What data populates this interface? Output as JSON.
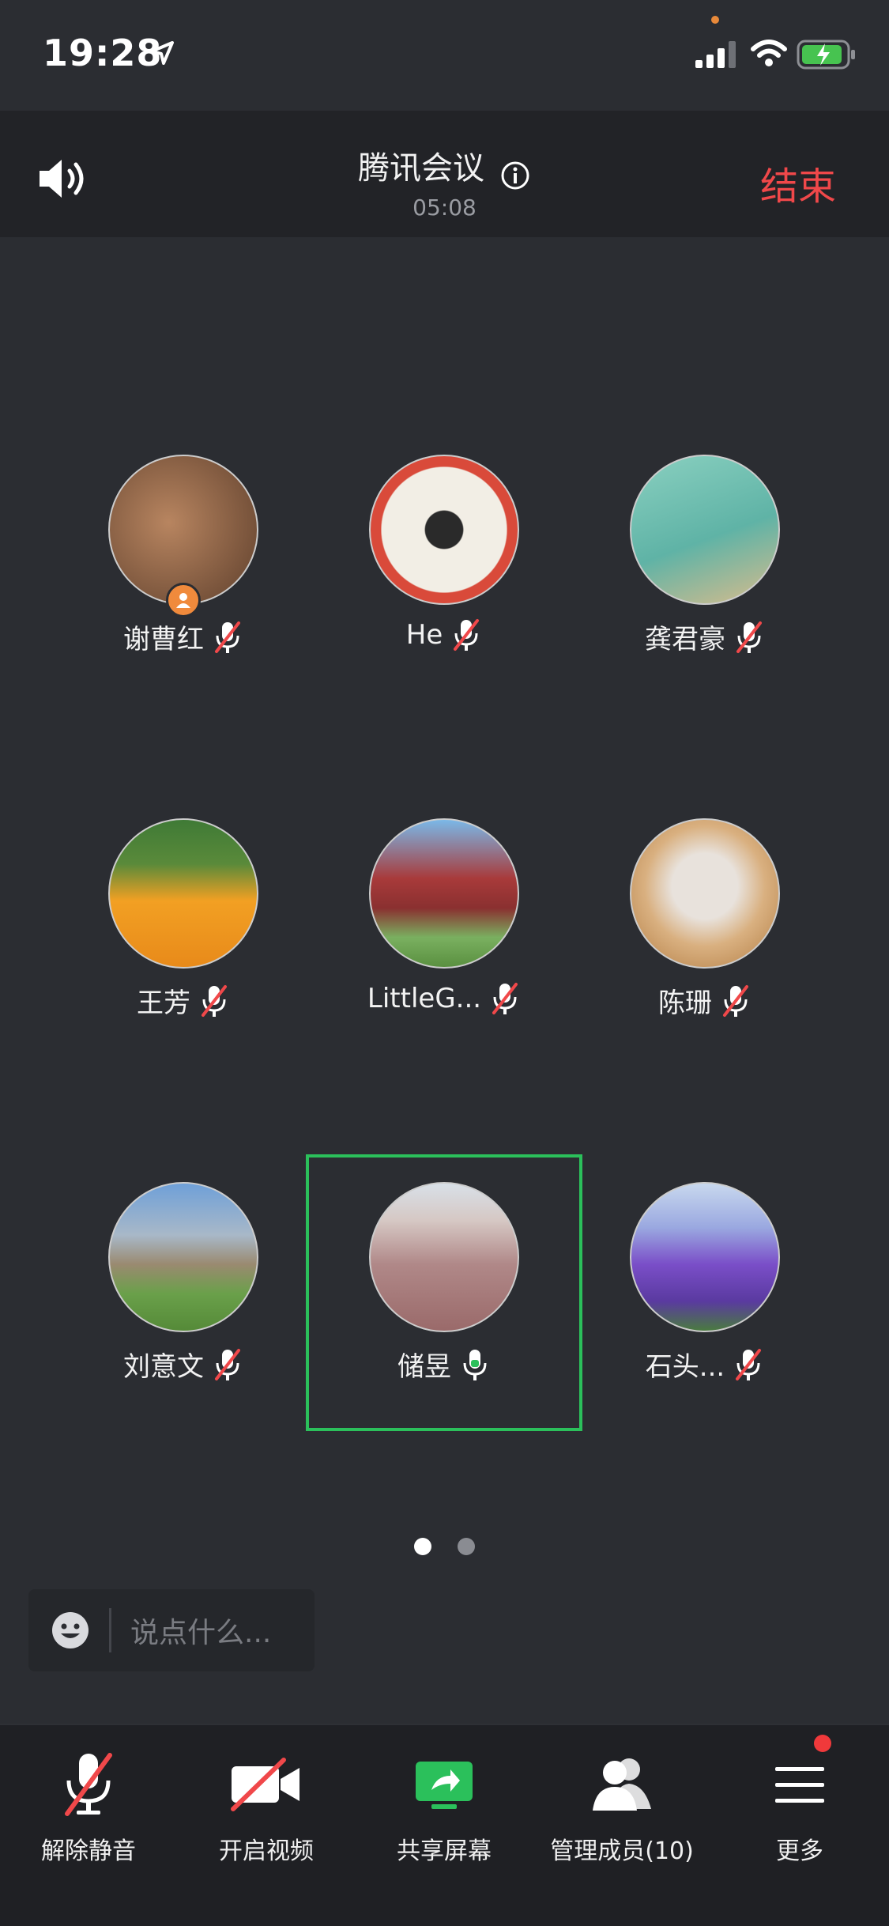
{
  "status_bar": {
    "time": "19:28"
  },
  "header": {
    "title": "腾讯会议",
    "timer": "05:08",
    "end_label": "结束"
  },
  "participants": [
    {
      "name": "谢曹红",
      "muted": true,
      "host": true,
      "avatar_colors": [
        "#b88560",
        "#5e3f2c"
      ]
    },
    {
      "name": "He",
      "muted": true,
      "host": false,
      "avatar_colors": [
        "#f2eee5",
        "#d94a3a"
      ]
    },
    {
      "name": "龚君豪",
      "muted": true,
      "host": false,
      "avatar_colors": [
        "#8ad0c0",
        "#d8bc8c"
      ]
    },
    {
      "name": "王芳",
      "muted": true,
      "host": false,
      "avatar_colors": [
        "#f2a023",
        "#3f7a36"
      ]
    },
    {
      "name": "LittleG...",
      "muted": true,
      "host": false,
      "avatar_colors": [
        "#7ab8e8",
        "#a83a3a"
      ]
    },
    {
      "name": "陈珊",
      "muted": true,
      "host": false,
      "avatar_colors": [
        "#d9b080",
        "#e8e2dc"
      ]
    },
    {
      "name": "刘意文",
      "muted": true,
      "host": false,
      "avatar_colors": [
        "#6fa0d8",
        "#6aa04a"
      ]
    },
    {
      "name": "储昱",
      "muted": false,
      "host": false,
      "avatar_colors": [
        "#d6c8c4",
        "#9a6a6a"
      ]
    },
    {
      "name": "石头...",
      "muted": true,
      "host": false,
      "avatar_colors": [
        "#c8d8ee",
        "#7a4ec8"
      ]
    }
  ],
  "pagination": {
    "current": 1,
    "total": 2
  },
  "chat": {
    "placeholder": "说点什么..."
  },
  "toolbar": {
    "unmute_label": "解除静音",
    "video_label": "开启视频",
    "share_label": "共享屏幕",
    "members_label": "管理成员(10)",
    "more_label": "更多"
  },
  "colors": {
    "accent_green": "#2bc05b",
    "end_red": "#f0484a",
    "host_orange": "#f08a3c",
    "notif_red": "#f0393b"
  }
}
